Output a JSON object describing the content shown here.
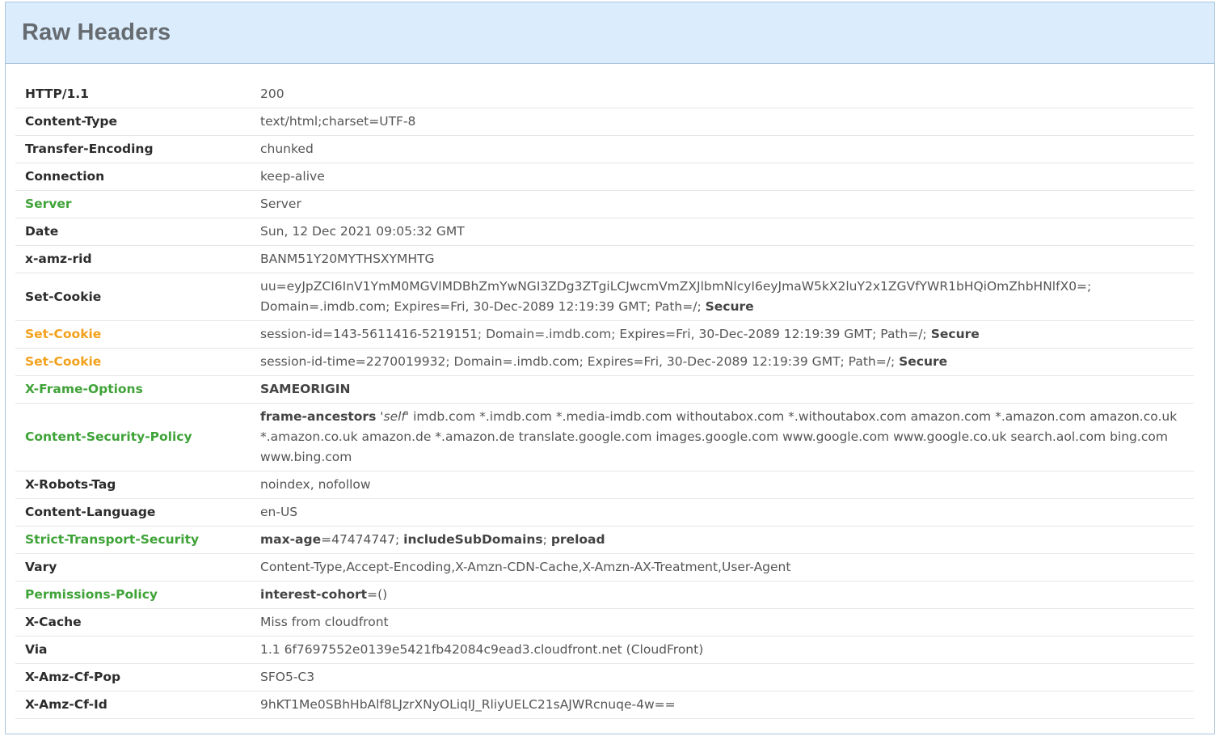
{
  "panel": {
    "title": "Raw Headers"
  },
  "colors": {
    "security_header": "#3fa338",
    "warning_header": "#f3a11b",
    "normal_header": "#2c2c2c"
  },
  "headers": [
    {
      "name": "HTTP/1.1",
      "status": "normal",
      "value": "200"
    },
    {
      "name": "Content-Type",
      "status": "normal",
      "value": "text/html;charset=UTF-8"
    },
    {
      "name": "Transfer-Encoding",
      "status": "normal",
      "value": "chunked"
    },
    {
      "name": "Connection",
      "status": "normal",
      "value": "keep-alive"
    },
    {
      "name": "Server",
      "status": "good",
      "value": "Server"
    },
    {
      "name": "Date",
      "status": "normal",
      "value": "Sun, 12 Dec 2021 09:05:32 GMT"
    },
    {
      "name": "x-amz-rid",
      "status": "normal",
      "value": "BANM51Y20MYTHSXYMHTG"
    },
    {
      "name": "Set-Cookie",
      "status": "normal",
      "value": "uu=eyJpZCI6InV1YmM0MGVlMDBhZmYwNGI3ZDg3ZTgiLCJwcmVmZXJlbmNlcyI6eyJmaW5kX2luY2x1ZGVfYWR1bHQiOmZhbHNlfX0=; Domain=.imdb.com; Expires=Fri, 30-Dec-2089 12:19:39 GMT; Path=/;",
      "flag": "Secure"
    },
    {
      "name": "Set-Cookie",
      "status": "warn",
      "value": "session-id=143-5611416-5219151; Domain=.imdb.com; Expires=Fri, 30-Dec-2089 12:19:39 GMT; Path=/;",
      "flag": "Secure"
    },
    {
      "name": "Set-Cookie",
      "status": "warn",
      "value": "session-id-time=2270019932; Domain=.imdb.com; Expires=Fri, 30-Dec-2089 12:19:39 GMT; Path=/;",
      "flag": "Secure"
    },
    {
      "name": "X-Frame-Options",
      "status": "good",
      "value_bold": "SAMEORIGIN"
    },
    {
      "name": "Content-Security-Policy",
      "status": "good",
      "directive": "frame-ancestors",
      "self": "'self'",
      "value": "imdb.com *.imdb.com *.media-imdb.com withoutabox.com *.withoutabox.com amazon.com *.amazon.com amazon.co.uk *.amazon.co.uk amazon.de *.amazon.de translate.google.com images.google.com www.google.com www.google.co.uk search.aol.com bing.com www.bing.com"
    },
    {
      "name": "X-Robots-Tag",
      "status": "normal",
      "value": "noindex, nofollow"
    },
    {
      "name": "Content-Language",
      "status": "normal",
      "value": "en-US"
    },
    {
      "name": "Strict-Transport-Security",
      "status": "good",
      "directive": "max-age",
      "eq": "=47474747;",
      "d2": "includeSubDomains",
      "sep": ";",
      "d3": "preload"
    },
    {
      "name": "Vary",
      "status": "normal",
      "value": "Content-Type,Accept-Encoding,X-Amzn-CDN-Cache,X-Amzn-AX-Treatment,User-Agent"
    },
    {
      "name": "Permissions-Policy",
      "status": "good",
      "directive": "interest-cohort",
      "eq": "=()"
    },
    {
      "name": "X-Cache",
      "status": "normal",
      "value": "Miss from cloudfront"
    },
    {
      "name": "Via",
      "status": "normal",
      "value": "1.1 6f7697552e0139e5421fb42084c9ead3.cloudfront.net (CloudFront)"
    },
    {
      "name": "X-Amz-Cf-Pop",
      "status": "normal",
      "value": "SFO5-C3"
    },
    {
      "name": "X-Amz-Cf-Id",
      "status": "normal",
      "value": "9hKT1Me0SBhHbAlf8LJzrXNyOLiqIJ_RliyUELC21sAJWRcnuqe-4w=="
    }
  ]
}
